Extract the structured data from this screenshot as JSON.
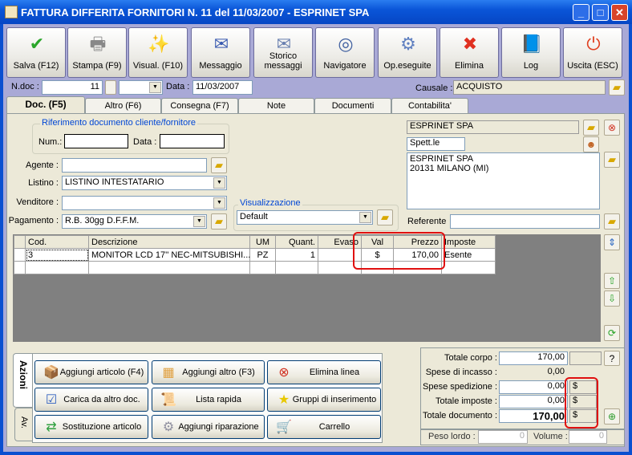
{
  "window": {
    "title": "FATTURA DIFFERITA FORNITORI N. 11  del 11/03/2007 - ESPRINET SPA"
  },
  "toolbar": [
    {
      "label": "Salva (F12)",
      "icon": "check-icon",
      "glyph": "✔",
      "color": "#2aa62a"
    },
    {
      "label": "Stampa (F9)",
      "icon": "printer-icon",
      "glyph": "🖶",
      "color": "#888"
    },
    {
      "label": "Visual. (F10)",
      "icon": "magic-wand-icon",
      "glyph": "✨",
      "color": "#d8b000"
    },
    {
      "label": "Messaggio",
      "icon": "envelope-pen-icon",
      "glyph": "✉",
      "color": "#3a5ab0"
    },
    {
      "label": "Storico messaggi",
      "icon": "envelope-search-icon",
      "glyph": "✉",
      "color": "#6a80b0"
    },
    {
      "label": "Navigatore",
      "icon": "compass-icon",
      "glyph": "◎",
      "color": "#4060a0"
    },
    {
      "label": "Op.eseguite",
      "icon": "gears-search-icon",
      "glyph": "⚙",
      "color": "#6080c0"
    },
    {
      "label": "Elimina",
      "icon": "delete-x-icon",
      "glyph": "✖",
      "color": "#e03020"
    },
    {
      "label": "Log",
      "icon": "log-book-icon",
      "glyph": "📘",
      "color": "#2060c0"
    },
    {
      "label": "Uscita (ESC)",
      "icon": "exit-icon",
      "glyph": "⏻",
      "color": "#e04020"
    }
  ],
  "header": {
    "ndoc_label": "N.doc :",
    "ndoc": "11",
    "data_label": "Data :",
    "data": "11/03/2007",
    "causale_label": "Causale :",
    "causale": "ACQUISTO"
  },
  "tabs": [
    "Doc. (F5)",
    "Altro (F6)",
    "Consegna (F7)",
    "Note",
    "Documenti",
    "Contabilita'"
  ],
  "riferimento": {
    "title": "Riferimento documento cliente/fornitore",
    "num_label": "Num.:",
    "num": "",
    "data_label": "Data :",
    "data": ""
  },
  "form": {
    "agente_label": "Agente :",
    "agente": "",
    "listino_label": "Listino :",
    "listino": "LISTINO INTESTATARIO",
    "venditore_label": "Venditore :",
    "venditore": "",
    "pagamento_label": "Pagamento :",
    "pagamento": "R.B. 30gg D.F.F.M."
  },
  "visualizzazione": {
    "title": "Visualizzazione",
    "value": "Default"
  },
  "cliente": {
    "name": "ESPRINET SPA",
    "spett": "Spett.le",
    "address1": "ESPRINET SPA",
    "address2": "20131 MILANO (MI)",
    "referente_label": "Referente",
    "referente": ""
  },
  "grid": {
    "columns": [
      "Cod.",
      "Descrizione",
      "UM",
      "Quant.",
      "Evaso",
      "Val",
      "Prezzo",
      "Imposte"
    ],
    "rows": [
      [
        "3",
        "MONITOR LCD 17'' NEC-MITSUBISHI...",
        "PZ",
        "1",
        "",
        "$",
        "170,00",
        "Esente"
      ]
    ]
  },
  "actions": {
    "tabs": [
      "Azioni",
      "Av."
    ],
    "buttons": [
      {
        "label": "Aggiungi articolo (F4)",
        "icon": "add-article-icon",
        "glyph": "📦"
      },
      {
        "label": "Aggiungi altro (F3)",
        "icon": "add-other-icon",
        "glyph": "▦"
      },
      {
        "label": "Elimina linea",
        "icon": "delete-line-icon",
        "glyph": "⊗"
      },
      {
        "label": "Carica da altro doc.",
        "icon": "load-document-icon",
        "glyph": "☑"
      },
      {
        "label": "Lista rapida",
        "icon": "quick-list-icon",
        "glyph": "📜"
      },
      {
        "label": "Gruppi di inserimento",
        "icon": "star-add-icon",
        "glyph": "★"
      },
      {
        "label": "Sostituzione articolo",
        "icon": "replace-article-icon",
        "glyph": "⇄"
      },
      {
        "label": "Aggiungi riparazione",
        "icon": "repair-gear-icon",
        "glyph": "⚙"
      },
      {
        "label": "Carrello",
        "icon": "cart-icon",
        "glyph": "🛒"
      }
    ]
  },
  "totals": {
    "corpo_label": "Totale corpo :",
    "corpo": "170,00",
    "incasso_label": "Spese di incasso :",
    "incasso": "0,00",
    "spedizione_label": "Spese spedizione :",
    "spedizione": "0,00",
    "spedizione_val": "$",
    "imposte_label": "Totale imposte :",
    "imposte": "0,00",
    "imposte_val": "$",
    "documento_label": "Totale documento :",
    "documento": "170,00",
    "documento_val": "$",
    "help": "?",
    "peso_label": "Peso lordo :",
    "peso": "0",
    "volume_label": "Volume :",
    "volume": "0"
  }
}
